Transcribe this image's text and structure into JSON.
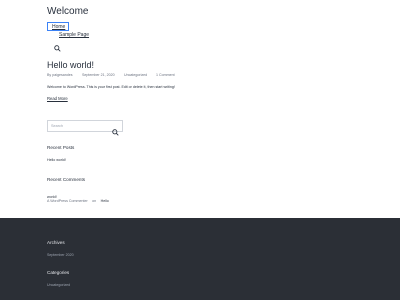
{
  "site": {
    "title": "Welcome"
  },
  "nav": {
    "items": [
      {
        "label": "Home"
      },
      {
        "label": "Sample Page"
      }
    ],
    "search_icon": "search-icon"
  },
  "post": {
    "title": "Hello world!",
    "meta": {
      "author": "By paigesandes",
      "date": "September 21, 2020",
      "category": "Uncategorized",
      "comments": "1 Comment"
    },
    "excerpt": "Welcome to WordPress. This is your first post. Edit or delete it, then start writing!",
    "read_more": "Read More"
  },
  "sidebar": {
    "search": {
      "placeholder": "Search",
      "icon": "search-icon"
    },
    "recent_posts": {
      "title": "Recent Posts",
      "items": [
        "Hello world!"
      ]
    },
    "recent_comments": {
      "title": "Recent Comments",
      "commenter": "A WordPress Commenter",
      "on_text": "on",
      "post_link_line1": "Hello",
      "post_link_line2": "world!"
    }
  },
  "footer": {
    "archives": {
      "title": "Archives",
      "items": [
        "September 2020"
      ]
    },
    "categories": {
      "title": "Categories",
      "items": [
        "Uncategorized"
      ]
    }
  },
  "colors": {
    "text": "#28303d",
    "muted": "#6b7280",
    "footer_bg": "#2b2f36",
    "focus_outline": "#3b82f6"
  }
}
